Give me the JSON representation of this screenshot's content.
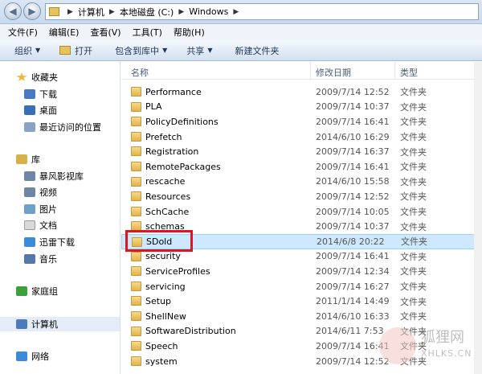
{
  "address": {
    "crumbs": [
      "计算机",
      "本地磁盘 (C:)",
      "Windows"
    ]
  },
  "menu": [
    "文件(F)",
    "编辑(E)",
    "查看(V)",
    "工具(T)",
    "帮助(H)"
  ],
  "toolbar": {
    "organize": "组织",
    "open": "打开",
    "include": "包含到库中",
    "share": "共享",
    "newfolder": "新建文件夹"
  },
  "nav": {
    "favorites": "收藏夹",
    "downloads": "下载",
    "desktop": "桌面",
    "recent": "最近访问的位置",
    "library": "库",
    "baofeng": "暴风影视库",
    "video": "视频",
    "pictures": "图片",
    "documents": "文档",
    "xunlei": "迅雷下载",
    "music": "音乐",
    "homegroup": "家庭组",
    "computer": "计算机",
    "network": "网络"
  },
  "columns": {
    "name": "名称",
    "date": "修改日期",
    "type": "类型"
  },
  "files": [
    {
      "name": "Performance",
      "date": "2009/7/14 12:52",
      "type": "文件夹"
    },
    {
      "name": "PLA",
      "date": "2009/7/14 10:37",
      "type": "文件夹"
    },
    {
      "name": "PolicyDefinitions",
      "date": "2009/7/14 16:41",
      "type": "文件夹"
    },
    {
      "name": "Prefetch",
      "date": "2014/6/10 16:29",
      "type": "文件夹"
    },
    {
      "name": "Registration",
      "date": "2009/7/14 16:37",
      "type": "文件夹"
    },
    {
      "name": "RemotePackages",
      "date": "2009/7/14 16:41",
      "type": "文件夹"
    },
    {
      "name": "rescache",
      "date": "2014/6/10 15:58",
      "type": "文件夹"
    },
    {
      "name": "Resources",
      "date": "2009/7/14 12:52",
      "type": "文件夹"
    },
    {
      "name": "SchCache",
      "date": "2009/7/14 10:05",
      "type": "文件夹"
    },
    {
      "name": "schemas",
      "date": "2009/7/14 10:37",
      "type": "文件夹"
    },
    {
      "name": "SDold",
      "date": "2014/6/8 20:22",
      "type": "文件夹"
    },
    {
      "name": "security",
      "date": "2009/7/14 16:41",
      "type": "文件夹"
    },
    {
      "name": "ServiceProfiles",
      "date": "2009/7/14 12:34",
      "type": "文件夹"
    },
    {
      "name": "servicing",
      "date": "2009/7/14 16:27",
      "type": "文件夹"
    },
    {
      "name": "Setup",
      "date": "2011/1/14 14:49",
      "type": "文件夹"
    },
    {
      "name": "ShellNew",
      "date": "2014/6/10 16:33",
      "type": "文件夹"
    },
    {
      "name": "SoftwareDistribution",
      "date": "2014/6/11 7:53",
      "type": "文件夹"
    },
    {
      "name": "Speech",
      "date": "2009/7/14 16:41",
      "type": "文件夹"
    },
    {
      "name": "system",
      "date": "2009/7/14 12:52",
      "type": "文件夹"
    }
  ],
  "watermark": {
    "cn": "狐狸网",
    "en": "XHLKS.CN"
  }
}
